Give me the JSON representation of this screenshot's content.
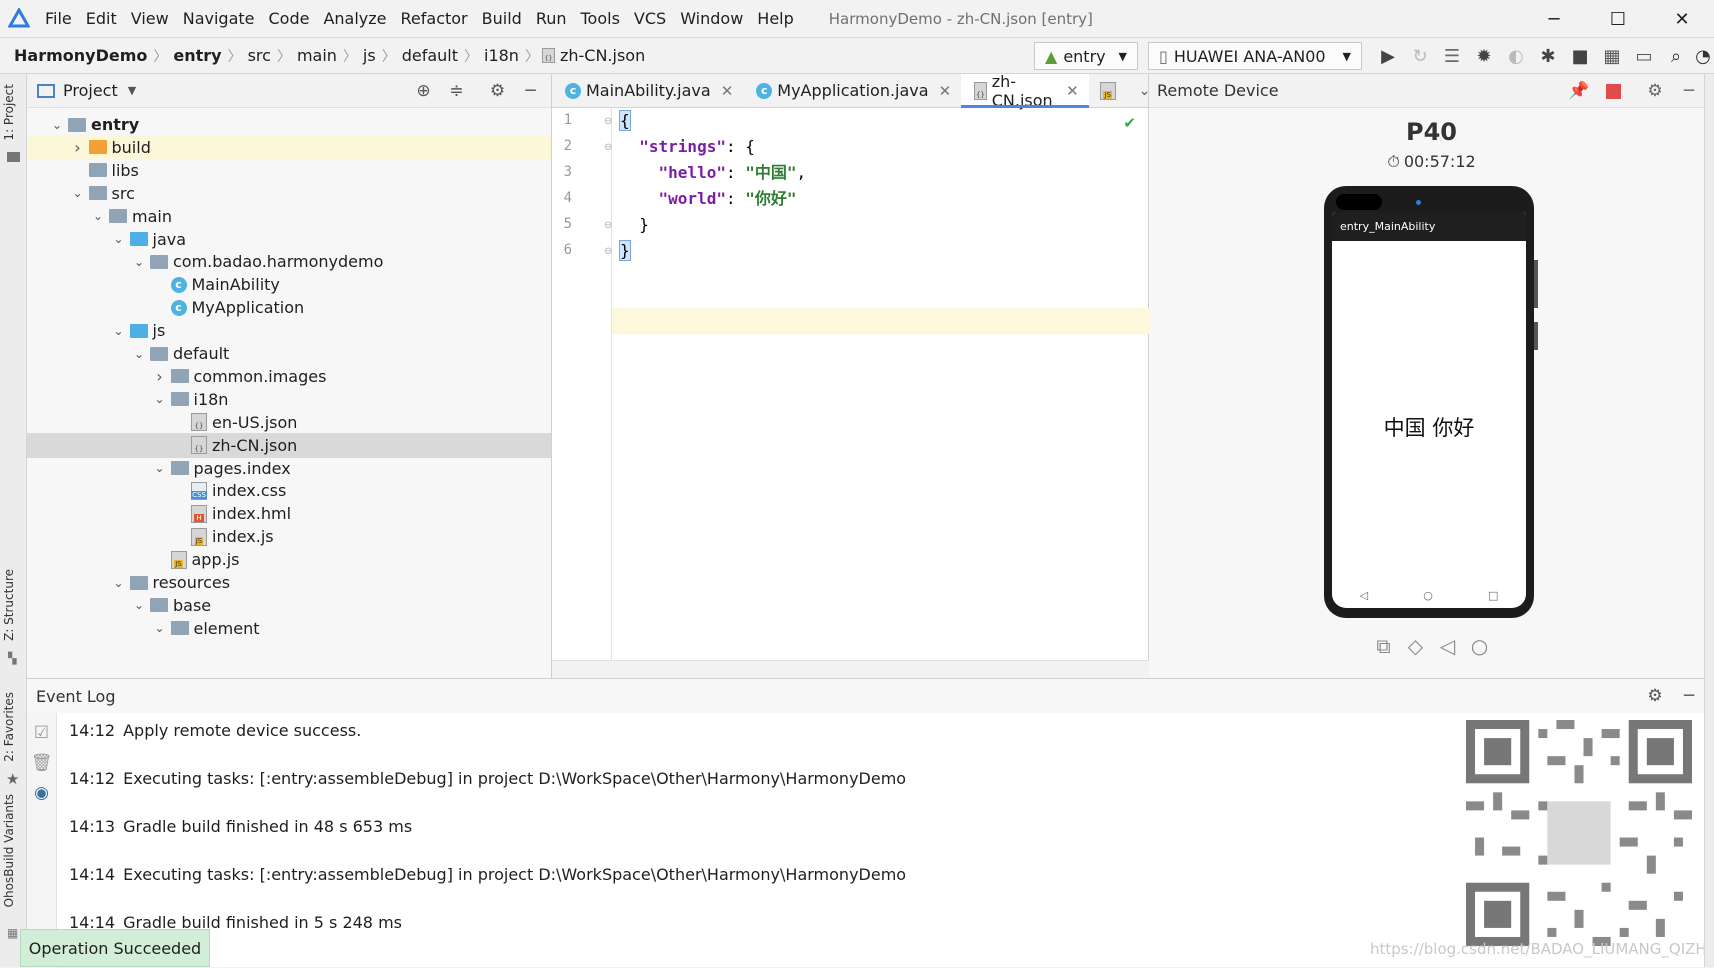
{
  "menubar": {
    "items": [
      "File",
      "Edit",
      "View",
      "Navigate",
      "Code",
      "Analyze",
      "Refactor",
      "Build",
      "Run",
      "Tools",
      "VCS",
      "Window",
      "Help"
    ],
    "title": "HarmonyDemo - zh-CN.json [entry]"
  },
  "navbar": {
    "crumbs": [
      "HarmonyDemo",
      "entry",
      "src",
      "main",
      "js",
      "default",
      "i18n",
      "zh-CN.json"
    ],
    "module_select": "entry",
    "device_select": "HUAWEI ANA-AN00"
  },
  "side_tabs": {
    "project": "1: Project",
    "structure": "Z: Structure",
    "favorites": "2: Favorites",
    "variants": "OhosBuild Variants"
  },
  "project_panel": {
    "title": "Project",
    "tree": [
      {
        "label": "entry",
        "depth": 0,
        "arrow": "down",
        "icon": "module",
        "bold": true
      },
      {
        "label": "build",
        "depth": 1,
        "arrow": "right",
        "icon": "folder-orange",
        "highlight": true
      },
      {
        "label": "libs",
        "depth": 1,
        "arrow": "",
        "icon": "folder"
      },
      {
        "label": "src",
        "depth": 1,
        "arrow": "down",
        "icon": "folder"
      },
      {
        "label": "main",
        "depth": 2,
        "arrow": "down",
        "icon": "folder"
      },
      {
        "label": "java",
        "depth": 3,
        "arrow": "down",
        "icon": "folder-blue"
      },
      {
        "label": "com.badao.harmonydemo",
        "depth": 4,
        "arrow": "down",
        "icon": "folder"
      },
      {
        "label": "MainAbility",
        "depth": 5,
        "arrow": "",
        "icon": "class"
      },
      {
        "label": "MyApplication",
        "depth": 5,
        "arrow": "",
        "icon": "class"
      },
      {
        "label": "js",
        "depth": 3,
        "arrow": "down",
        "icon": "folder-blue"
      },
      {
        "label": "default",
        "depth": 4,
        "arrow": "down",
        "icon": "folder"
      },
      {
        "label": "common.images",
        "depth": 5,
        "arrow": "right",
        "icon": "folder"
      },
      {
        "label": "i18n",
        "depth": 5,
        "arrow": "down",
        "icon": "folder"
      },
      {
        "label": "en-US.json",
        "depth": 6,
        "arrow": "",
        "icon": "json"
      },
      {
        "label": "zh-CN.json",
        "depth": 6,
        "arrow": "",
        "icon": "json",
        "selected": true
      },
      {
        "label": "pages.index",
        "depth": 5,
        "arrow": "down",
        "icon": "folder"
      },
      {
        "label": "index.css",
        "depth": 6,
        "arrow": "",
        "icon": "css"
      },
      {
        "label": "index.hml",
        "depth": 6,
        "arrow": "",
        "icon": "html"
      },
      {
        "label": "index.js",
        "depth": 6,
        "arrow": "",
        "icon": "js"
      },
      {
        "label": "app.js",
        "depth": 5,
        "arrow": "",
        "icon": "js"
      },
      {
        "label": "resources",
        "depth": 3,
        "arrow": "down",
        "icon": "folder"
      },
      {
        "label": "base",
        "depth": 4,
        "arrow": "down",
        "icon": "folder"
      },
      {
        "label": "element",
        "depth": 5,
        "arrow": "down",
        "icon": "folder"
      }
    ]
  },
  "editor": {
    "tabs": [
      {
        "label": "MainAbility.java",
        "icon": "class"
      },
      {
        "label": "MyApplication.java",
        "icon": "class"
      },
      {
        "label": "zh-CN.json",
        "icon": "json",
        "active": true
      }
    ],
    "line_numbers": [
      "1",
      "2",
      "3",
      "4",
      "5",
      "6"
    ],
    "lines": [
      "{",
      "\"strings\"",
      ": {",
      "\"hello\"",
      ": ",
      "\"中国\"",
      ",",
      "\"world\"",
      ": ",
      "\"你好\"",
      "}",
      "}"
    ]
  },
  "remote": {
    "title": "Remote Device",
    "device_name": "P40",
    "timer": "00:57:12",
    "app_bar": "entry_MainAbility",
    "screen_text": "中国 你好"
  },
  "event_log": {
    "title": "Event Log",
    "entries": [
      {
        "time": "14:12",
        "text": "Apply remote device success."
      },
      {
        "time": "14:12",
        "text": "Executing tasks: [:entry:assembleDebug] in project D:\\WorkSpace\\Other\\Harmony\\HarmonyDemo"
      },
      {
        "time": "14:13",
        "text": "Gradle build finished in 48 s 653 ms"
      },
      {
        "time": "14:14",
        "text": "Executing tasks: [:entry:assembleDebug] in project D:\\WorkSpace\\Other\\Harmony\\HarmonyDemo"
      },
      {
        "time": "14:14",
        "text": "Gradle build finished in 5 s 248 ms"
      }
    ]
  },
  "toast": "Operation Succeeded",
  "watermark": "https://blog.csdn.net/BADAO_LIUMANG_QIZHI",
  "colors": {
    "accent": "#4a86e8",
    "json_key": "#7b1fa2",
    "json_string": "#2e7d32"
  }
}
